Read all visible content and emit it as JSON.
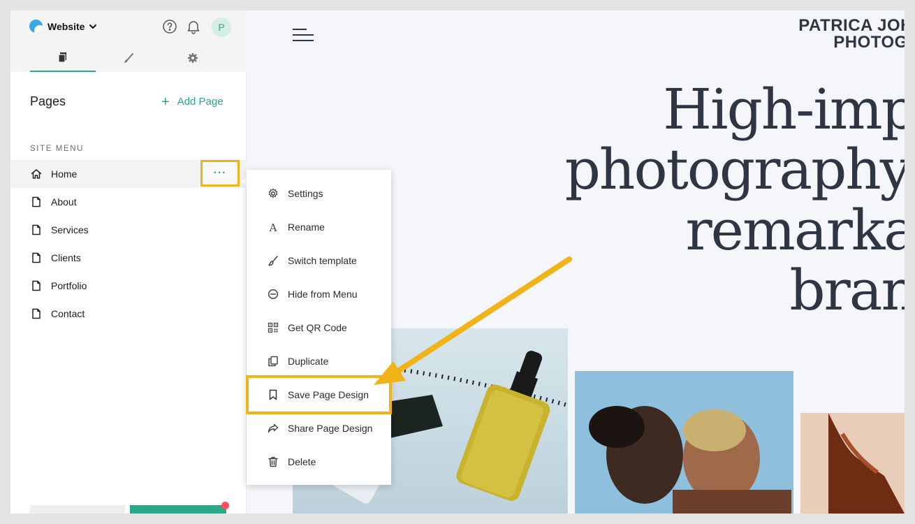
{
  "topbar": {
    "site_label": "Website",
    "avatar_letter": "P"
  },
  "tabs": [
    "pages-tab",
    "design-tab",
    "settings-tab"
  ],
  "pages_panel": {
    "title": "Pages",
    "add_page": "Add Page",
    "site_menu_label": "SITE MENU",
    "items": [
      {
        "label": "Home",
        "icon": "home-icon"
      },
      {
        "label": "About",
        "icon": "page-icon"
      },
      {
        "label": "Services",
        "icon": "page-icon"
      },
      {
        "label": "Clients",
        "icon": "page-icon"
      },
      {
        "label": "Portfolio",
        "icon": "page-icon"
      },
      {
        "label": "Contact",
        "icon": "page-icon"
      }
    ],
    "more_button": "···"
  },
  "context_menu": {
    "items": [
      {
        "label": "Settings",
        "icon": "gear-icon"
      },
      {
        "label": "Rename",
        "icon": "text-icon"
      },
      {
        "label": "Switch template",
        "icon": "brush-icon"
      },
      {
        "label": "Hide from Menu",
        "icon": "minus-circle-icon"
      },
      {
        "label": "Get QR Code",
        "icon": "qr-code-icon"
      },
      {
        "label": "Duplicate",
        "icon": "duplicate-icon"
      },
      {
        "label": "Save Page Design",
        "icon": "bookmark-icon"
      },
      {
        "label": "Share Page Design",
        "icon": "share-icon"
      },
      {
        "label": "Delete",
        "icon": "trash-icon"
      }
    ]
  },
  "preview": {
    "brand_line1": "PATRICA JOH",
    "brand_line2": "PHOTOGI",
    "hero_lines": [
      "High-imp",
      "photography",
      "remarka",
      "bran"
    ]
  },
  "colors": {
    "accent": "#2aa887",
    "highlight": "#f2b319",
    "notification": "#ff4f5f",
    "text_dark": "#2d3642"
  }
}
